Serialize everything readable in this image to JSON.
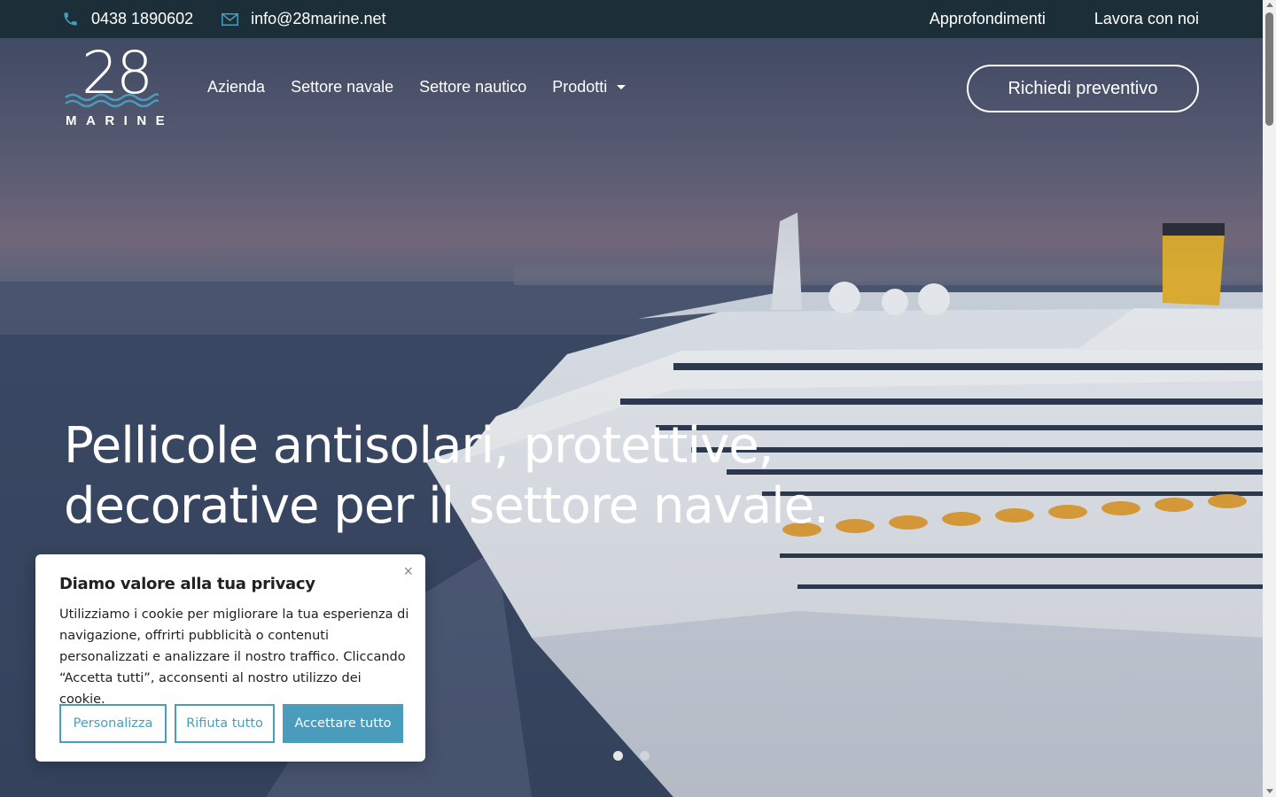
{
  "topbar": {
    "phone": "0438 1890602",
    "email": "info@28marine.net",
    "links": [
      "Approfondimenti",
      "Lavora con noi"
    ]
  },
  "logo": {
    "number": "28",
    "word": "MARINE"
  },
  "nav": {
    "items": [
      "Azienda",
      "Settore navale",
      "Settore nautico",
      "Prodotti"
    ],
    "cta": "Richiedi preventivo"
  },
  "hero": {
    "line1": "Pellicole antisolari, protettive,",
    "line2": "decorative per il settore navale.",
    "slides": 2,
    "active_slide": 1
  },
  "cookie": {
    "title": "Diamo valore alla tua privacy",
    "body": "Utilizziamo i cookie per migliorare la tua esperienza di navigazione, offrirti pubblicità o contenuti personalizzati e analizzare il nostro traffico. Cliccando “Accetta tutti”, acconsenti al nostro utilizzo dei cookie.",
    "close": "×",
    "buttons": {
      "customize": "Personalizza",
      "reject": "Rifiuta tutto",
      "accept": "Accettare tutto"
    }
  },
  "colors": {
    "topbar": "#1c2f38",
    "accent": "#4a9cbc"
  }
}
